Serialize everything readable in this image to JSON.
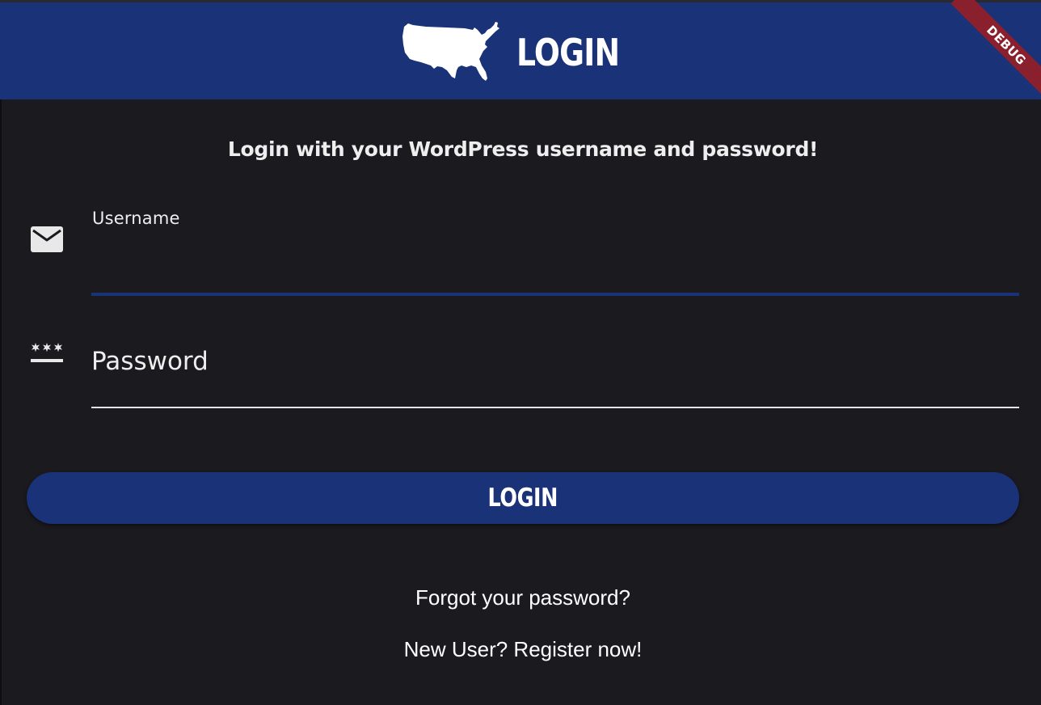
{
  "appbar": {
    "title": "LOGIN",
    "logo_icon": "usa-map-icon",
    "background_color": "#1a3278"
  },
  "debug_banner": {
    "label": "DEBUG",
    "color": "#8a1f2d"
  },
  "form": {
    "instructions": "Login with your WordPress username and password!",
    "username": {
      "label": "Username",
      "value": "",
      "icon": "mail-icon"
    },
    "password": {
      "placeholder": "Password",
      "value": "",
      "icon": "password-icon"
    }
  },
  "actions": {
    "login_label": "LOGIN",
    "forgot_label": "Forgot your password?",
    "register_label": "New User? Register now!"
  },
  "colors": {
    "background": "#1b1a1f",
    "accent": "#1a3278",
    "text": "#ffffff"
  }
}
